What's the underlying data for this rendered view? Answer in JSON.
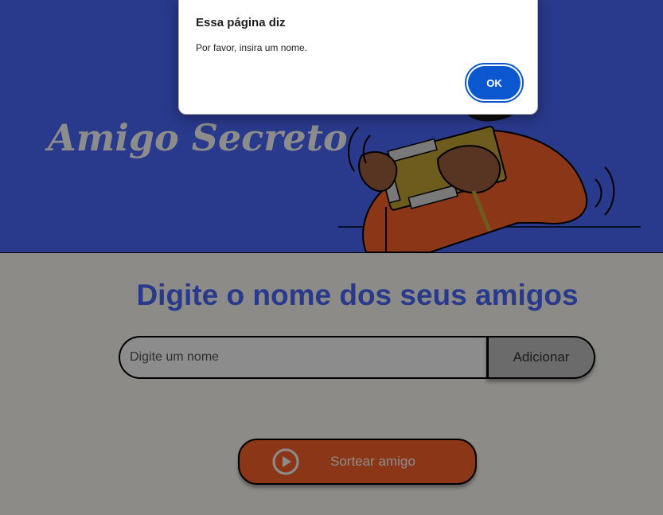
{
  "header": {
    "title": "Amigo Secreto",
    "background_color": "#4b69fd",
    "illustration_icon": "person-holding-gift-illustration"
  },
  "main": {
    "section_title": "Digite o nome dos seus amigos",
    "name_input": {
      "placeholder": "Digite um nome",
      "value": ""
    },
    "add_button_label": "Adicionar",
    "draw_button": {
      "label": "Sortear amigo",
      "icon": "play-circle-icon",
      "color": "#fe652b"
    },
    "background_color": "#fffdf6"
  },
  "dialog": {
    "title": "Essa página diz",
    "message": "Por favor, insira um nome.",
    "ok_label": "OK",
    "accent_color": "#0b57d0"
  }
}
